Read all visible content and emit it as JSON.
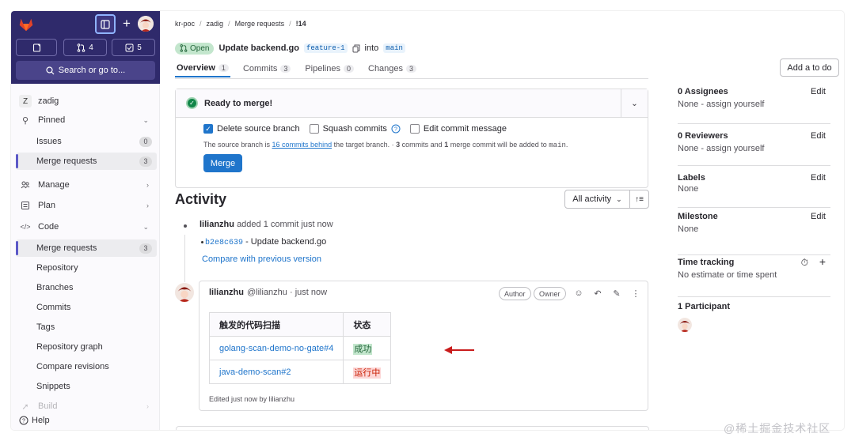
{
  "sidebar": {
    "counters": {
      "mr": "4",
      "todo": "5"
    },
    "search_label": "Search or go to...",
    "project_initial": "Z",
    "project_name": "zadig",
    "pinned": "Pinned",
    "items": {
      "issues": "Issues",
      "issues_count": "0",
      "mr_pinned": "Merge requests",
      "mr_pinned_count": "3",
      "manage": "Manage",
      "plan": "Plan",
      "code": "Code",
      "mr": "Merge requests",
      "mr_count": "3",
      "repository": "Repository",
      "branches": "Branches",
      "commits": "Commits",
      "tags": "Tags",
      "repo_graph": "Repository graph",
      "compare": "Compare revisions",
      "snippets": "Snippets",
      "build": "Build"
    },
    "help": "Help"
  },
  "breadcrumb": [
    "kr-poc",
    "zadig",
    "Merge requests",
    "!14"
  ],
  "mr": {
    "status": "Open",
    "title": "Update backend.go",
    "source_branch": "feature-1",
    "into": "into",
    "target_branch": "main"
  },
  "tabs": [
    {
      "label": "Overview",
      "count": "1"
    },
    {
      "label": "Commits",
      "count": "3"
    },
    {
      "label": "Pipelines",
      "count": "0"
    },
    {
      "label": "Changes",
      "count": "3"
    }
  ],
  "todo_button": "Add a to do",
  "merge_widget": {
    "status": "Ready to merge!",
    "delete_source": "Delete source branch",
    "squash": "Squash commits",
    "edit_msg": "Edit commit message",
    "info_pre": "The source branch is ",
    "info_link": "16 commits behind",
    "info_mid": " the target branch. · ",
    "info_b1": "3",
    "info_t1": " commits and ",
    "info_b2": "1",
    "info_t2": " merge commit will be added to ",
    "info_branch": "main",
    "info_end": ".",
    "merge_button": "Merge"
  },
  "activity": {
    "title": "Activity",
    "filter": "All activity",
    "event_user": "lilianzhu",
    "event_text": "added 1 commit just now",
    "commit_sha": "b2e8c639",
    "commit_msg": "- Update backend.go",
    "compare_link": "Compare with previous version"
  },
  "note": {
    "author": "lilianzhu",
    "handle": "@lilianzhu · just now",
    "role_author": "Author",
    "role_owner": "Owner",
    "table_headers": [
      "触发的代码扫描",
      "状态"
    ],
    "rows": [
      {
        "scan": "golang-scan-demo-no-gate#4",
        "status": "成功"
      },
      {
        "scan": "java-demo-scan#2",
        "status": "运行中"
      }
    ],
    "edited": "Edited just now by lilianzhu"
  },
  "right_sidebar": {
    "assignees_title": "0 Assignees",
    "assignees_val": "None - assign yourself",
    "reviewers_title": "0 Reviewers",
    "reviewers_val": "None - assign yourself",
    "labels_title": "Labels",
    "labels_val": "None",
    "milestone_title": "Milestone",
    "milestone_val": "None",
    "time_title": "Time tracking",
    "time_val": "No estimate or time spent",
    "participants_title": "1 Participant",
    "edit": "Edit"
  },
  "watermark": "@稀土掘金技术社区",
  "colors": {
    "brand": "#2f2a6b",
    "link": "#1f75cb",
    "success": "#108548",
    "arrow": "#c91c1c"
  }
}
